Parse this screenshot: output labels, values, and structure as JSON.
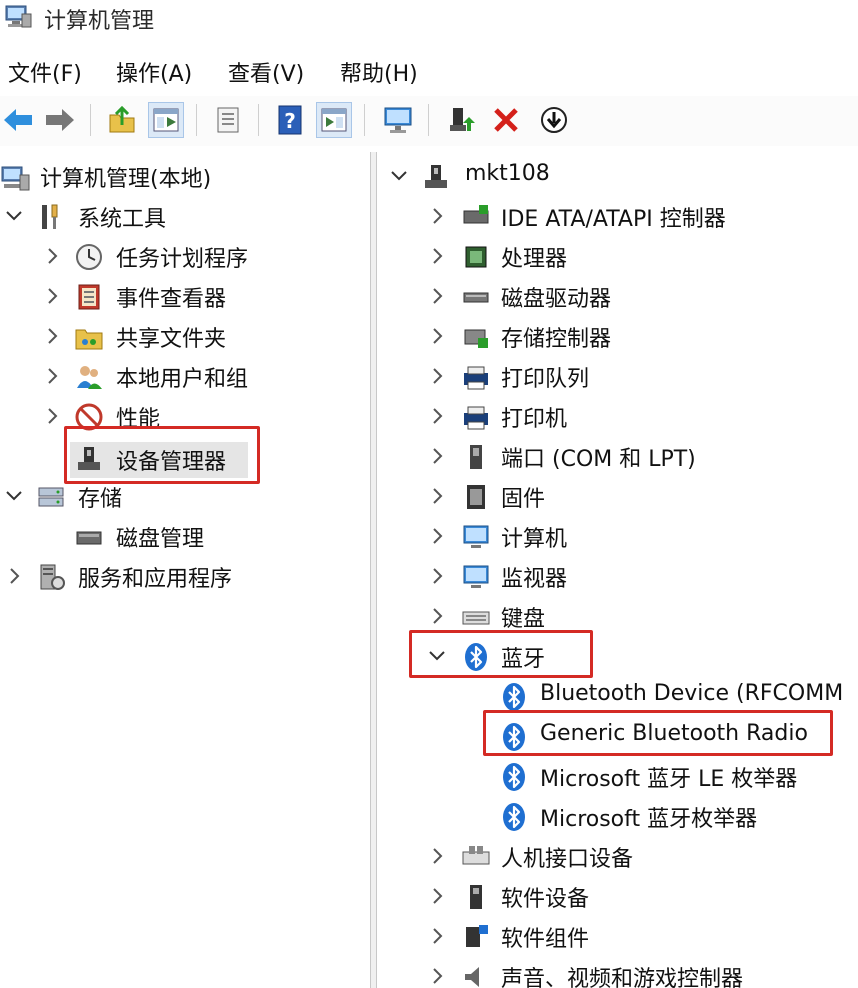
{
  "window": {
    "title": "计算机管理"
  },
  "menu": [
    "文件(F)",
    "操作(A)",
    "查看(V)",
    "帮助(H)"
  ],
  "toolbar": [
    "back-icon",
    "forward-icon",
    "up-folder-icon",
    "show-hide-tree-icon",
    "properties-icon",
    "help-icon",
    "action-pane-icon",
    "monitor-icon",
    "update-driver-icon",
    "uninstall-icon",
    "download-icon"
  ],
  "left_tree": {
    "root": "计算机管理(本地)",
    "system_tools": "系统工具",
    "task_scheduler": "任务计划程序",
    "event_viewer": "事件查看器",
    "shared_folders": "共享文件夹",
    "local_users": "本地用户和组",
    "performance": "性能",
    "device_manager": "设备管理器",
    "storage": "存储",
    "disk_management": "磁盘管理",
    "services_apps": "服务和应用程序"
  },
  "right_tree": {
    "computer_name": "mkt108",
    "categories": [
      "IDE ATA/ATAPI 控制器",
      "处理器",
      "磁盘驱动器",
      "存储控制器",
      "打印队列",
      "打印机",
      "端口 (COM 和 LPT)",
      "固件",
      "计算机",
      "监视器",
      "键盘"
    ],
    "bluetooth": {
      "label": "蓝牙",
      "children": [
        "Bluetooth Device (RFCOMM",
        "Generic Bluetooth Radio",
        "Microsoft 蓝牙 LE 枚举器",
        "Microsoft 蓝牙枚举器"
      ]
    },
    "after": [
      "人机接口设备",
      "软件设备",
      "软件组件",
      "声音、视频和游戏控制器"
    ]
  },
  "colors": {
    "highlight": "#d42a24",
    "bluetooth": "#1f6fd1",
    "selected": "#e5e5e5"
  }
}
